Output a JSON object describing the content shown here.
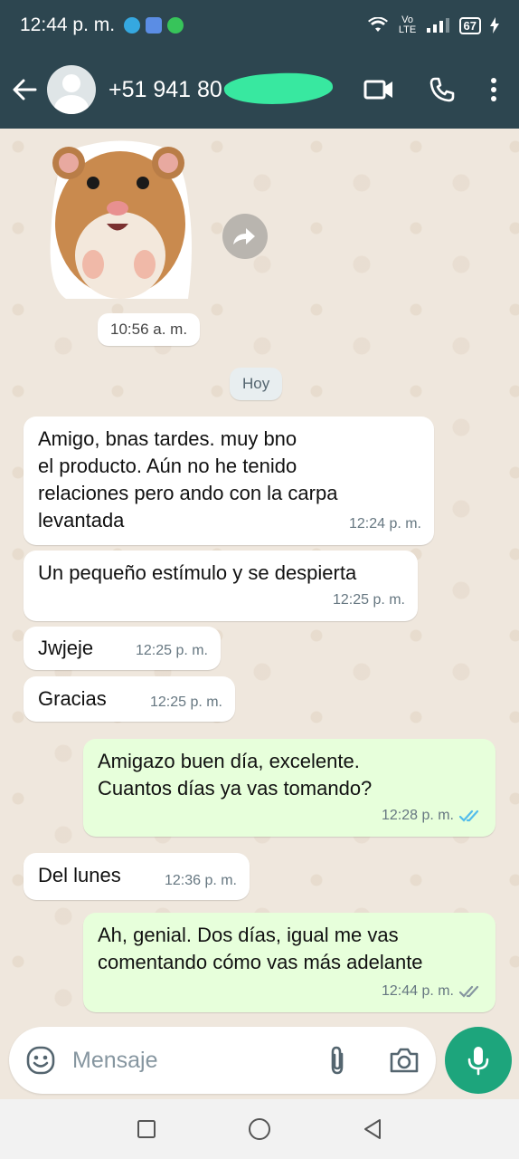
{
  "status_bar": {
    "time": "12:44 p. m.",
    "network": "Vo LTE",
    "battery": "67"
  },
  "app_bar": {
    "contact_name": "+51 941 80"
  },
  "sticker": {
    "time": "10:56 a. m."
  },
  "day_separator": "Hoy",
  "messages": [
    {
      "dir": "in",
      "lines": [
        "Amigo, bnas tardes. muy bno",
        "el producto. Aún no he tenido",
        "relaciones pero ando con la carpa",
        "levantada"
      ],
      "time": "12:24 p. m."
    },
    {
      "dir": "in",
      "lines": [
        "Un pequeño estímulo y se despierta"
      ],
      "time": "12:25 p. m."
    },
    {
      "dir": "in",
      "lines": [
        "Jwjeje"
      ],
      "time": "12:25 p. m."
    },
    {
      "dir": "in",
      "lines": [
        "Gracias"
      ],
      "time": "12:25 p. m."
    },
    {
      "dir": "out",
      "lines": [
        "Amigazo buen día, excelente.",
        "Cuantos días ya vas tomando?"
      ],
      "time": "12:28 p. m.",
      "status": "read"
    },
    {
      "dir": "in",
      "lines": [
        "Del lunes"
      ],
      "time": "12:36 p. m."
    },
    {
      "dir": "out",
      "lines": [
        "Ah, genial. Dos días, igual me vas",
        "comentando cómo vas más adelante"
      ],
      "time": "12:44 p. m.",
      "status": "delivered"
    }
  ],
  "input": {
    "placeholder": "Mensaje"
  },
  "colors": {
    "header": "#2d4650",
    "chat_bg": "#efe7dd",
    "outgoing_bubble": "#e7ffdb",
    "accent": "#1da57c",
    "read_tick": "#53bdeb"
  },
  "icons": {
    "back": "arrow-left-icon",
    "video": "video-call-icon",
    "call": "phone-icon",
    "menu": "more-vert-icon",
    "emoji": "emoji-icon",
    "attach": "paperclip-icon",
    "camera": "camera-icon",
    "mic": "microphone-icon",
    "forward": "forward-icon"
  }
}
